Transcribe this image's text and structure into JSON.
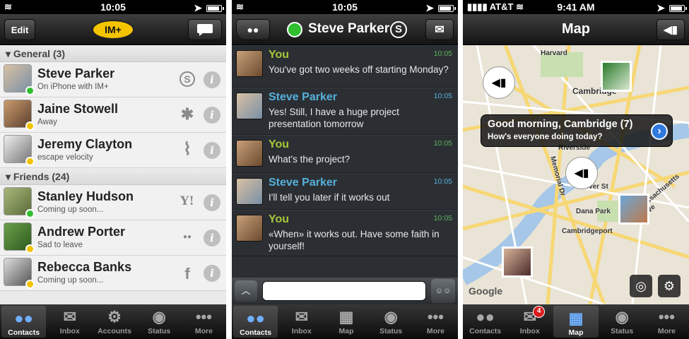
{
  "colors": {
    "online": "#2fbf2f",
    "away": "#f2c400",
    "you": "#a6c83a",
    "steve": "#57b0dc",
    "time": "#5fb35f"
  },
  "screen1": {
    "status": {
      "time": "10:05"
    },
    "nav": {
      "edit": "Edit",
      "logo": "IM+"
    },
    "sections": [
      {
        "title": "General (3)",
        "contacts": [
          {
            "name": "Steve Parker",
            "status": "On iPhone with IM+",
            "service": "S",
            "presence": "online"
          },
          {
            "name": "Jaine Stowell",
            "status": "Away",
            "service": "✱",
            "presence": "away"
          },
          {
            "name": "Jeremy Clayton",
            "status": "escape velocity",
            "service": "⌇",
            "presence": "away"
          }
        ]
      },
      {
        "title": "Friends (24)",
        "contacts": [
          {
            "name": "Stanley Hudson",
            "status": "Coming up soon...",
            "service": "Y!",
            "presence": "online"
          },
          {
            "name": "Andrew Porter",
            "status": "Sad to leave",
            "service": "●●",
            "presence": "away"
          },
          {
            "name": "Rebecca Banks",
            "status": "Coming up soon...",
            "service": "f",
            "presence": "away"
          }
        ]
      }
    ],
    "info": "i",
    "tabs": [
      {
        "label": "Contacts",
        "icon": "contacts-icon"
      },
      {
        "label": "Inbox",
        "icon": "inbox-icon"
      },
      {
        "label": "Accounts",
        "icon": "accounts-icon"
      },
      {
        "label": "Status",
        "icon": "status-icon"
      },
      {
        "label": "More",
        "icon": "more-icon"
      }
    ]
  },
  "screen2": {
    "status": {
      "time": "10:05"
    },
    "title": "Steve Parker",
    "messages": [
      {
        "who": "You",
        "text": "You've got two weeks off starting Monday?",
        "time": "10:05"
      },
      {
        "who": "Steve Parker",
        "text": "Yes! Still, I have a huge project presentation tomorrow",
        "time": "10:05"
      },
      {
        "who": "You",
        "text": "What's the project?",
        "time": "10:05"
      },
      {
        "who": "Steve Parker",
        "text": "I'll tell you later if it works out",
        "time": "10:05"
      },
      {
        "who": "You",
        "text": "«When» it works out. Have some faith in yourself!",
        "time": "10:05"
      }
    ],
    "tabs": [
      {
        "label": "Contacts",
        "icon": "contacts-icon"
      },
      {
        "label": "Inbox",
        "icon": "inbox-icon"
      },
      {
        "label": "Map",
        "icon": "map-icon"
      },
      {
        "label": "Status",
        "icon": "status-icon"
      },
      {
        "label": "More",
        "icon": "more-icon"
      }
    ]
  },
  "screen3": {
    "status": {
      "carrier": "AT&T",
      "time": "9:41 AM"
    },
    "title": "Map",
    "callout": {
      "title": "Good morning, Cambridge (7)",
      "subtitle": "How's everyone doing today?"
    },
    "labels": [
      "Harvard",
      "Cambridge",
      "Riverside",
      "Memorial Dr",
      "River St",
      "Dana Park",
      "Cambridgeport",
      "Massachusetts Ave"
    ],
    "google": "Google",
    "tabs": [
      {
        "label": "Contacts",
        "icon": "contacts-icon"
      },
      {
        "label": "Inbox",
        "icon": "inbox-icon",
        "badge": "4"
      },
      {
        "label": "Map",
        "icon": "map-icon"
      },
      {
        "label": "Status",
        "icon": "status-icon"
      },
      {
        "label": "More",
        "icon": "more-icon"
      }
    ]
  }
}
